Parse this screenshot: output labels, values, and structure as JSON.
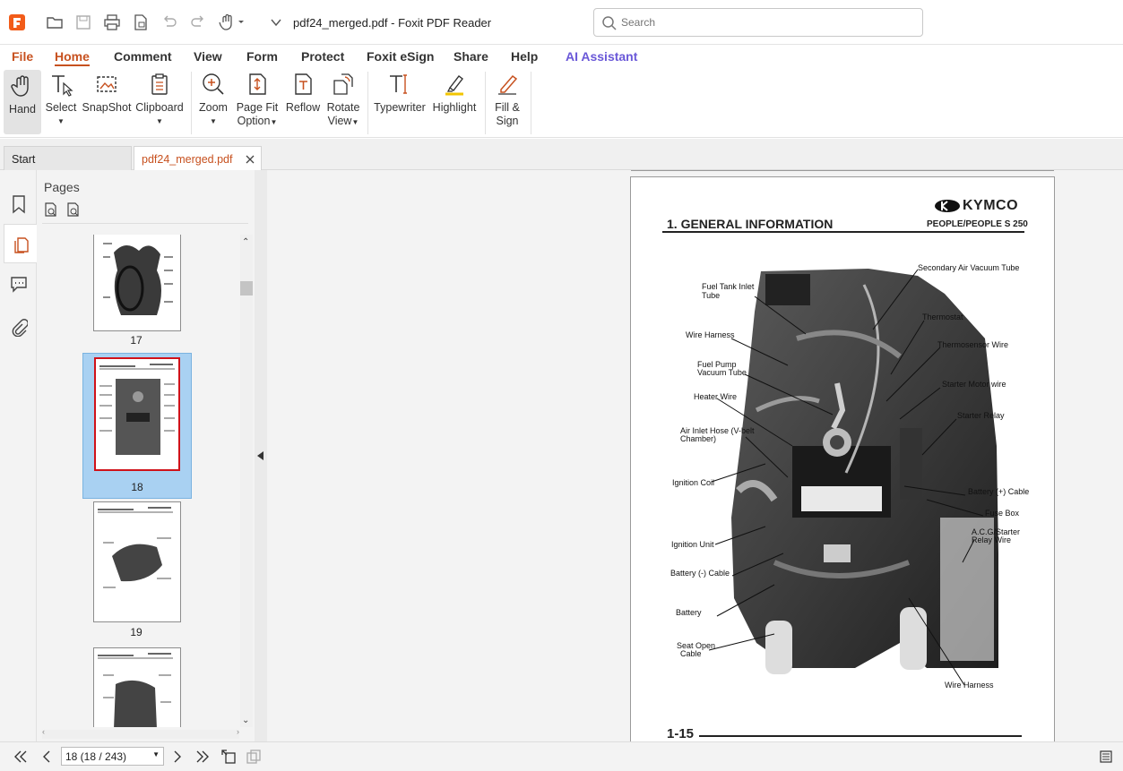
{
  "window": {
    "doc_title": "pdf24_merged.pdf - Foxit PDF Reader",
    "search_placeholder": "Search"
  },
  "menu": [
    "File",
    "Home",
    "Comment",
    "View",
    "Form",
    "Protect",
    "Foxit eSign",
    "Share",
    "Help",
    "AI Assistant"
  ],
  "ribbon": {
    "hand": "Hand",
    "select": "Select",
    "snapshot": "SnapShot",
    "clipboard": "Clipboard",
    "zoom": "Zoom",
    "page_fit_1": "Page Fit",
    "page_fit_2": "Option",
    "reflow": "Reflow",
    "rotate_1": "Rotate",
    "rotate_2": "View",
    "typewriter": "Typewriter",
    "highlight": "Highlight",
    "fill_sign_1": "Fill &",
    "fill_sign_2": "Sign"
  },
  "tabs": {
    "start": "Start",
    "doc": "pdf24_merged.pdf"
  },
  "pages_panel": {
    "title": "Pages",
    "thumbs": [
      {
        "label": "17"
      },
      {
        "label": "18"
      },
      {
        "label": "19"
      }
    ]
  },
  "page": {
    "brand": "KYMCO",
    "section_title": "1. GENERAL INFORMATION",
    "model": "PEOPLE/PEOPLE S 250",
    "page_number": "1-15",
    "labels": [
      "Fuel Tank Inlet",
      "Tube",
      "Secondary Air Vacuum Tube",
      "Wire Harness",
      "Thermostat",
      "Thermosensor Wire",
      "Fuel Pump",
      "Vacuum Tube",
      "Starter Motor wire",
      "Heater Wire",
      "Starter Relay",
      "Air Inlet Hose (V-belt",
      "Chamber)",
      "Ignition Coil",
      "Battery (+) Cable",
      "Fuse Box",
      "A.C.G/Starter",
      "Relay Wire",
      "Ignition Unit",
      "Battery (-) Cable",
      "Battery",
      "Seat Open",
      "Cable",
      "Wire Harness"
    ]
  },
  "status": {
    "page_field": "18 (18 / 243)"
  },
  "colors": {
    "accent": "#c7511f",
    "ai": "#6a58d8",
    "selected_thumb": "#a9d1f2"
  }
}
